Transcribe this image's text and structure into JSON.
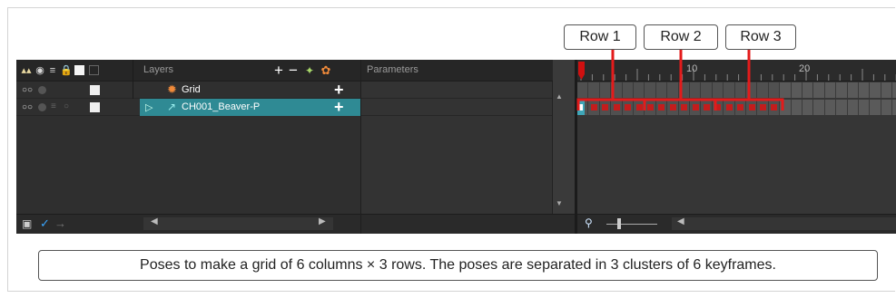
{
  "callouts": {
    "row1": "Row 1",
    "row2": "Row 2",
    "row3": "Row 3"
  },
  "layers_panel": {
    "header_label": "Layers",
    "parameters_label": "Parameters",
    "layers": [
      {
        "name": "Grid",
        "icon": "sun-icon",
        "selected": false
      },
      {
        "name": "CH001_Beaver-P",
        "icon": "peg-icon",
        "selected": true
      }
    ]
  },
  "timeline": {
    "ruler_labels": [
      "10",
      "20"
    ],
    "playhead_frame": "1",
    "keyframe_clusters": 3,
    "keyframes_per_cluster": 6
  },
  "caption": "Poses to make a grid of 6 columns × 3 rows. The poses are separated in 3 clusters of 6 keyframes.",
  "colors": {
    "accent_selected": "#2f8a94",
    "keyframe": "#c41c1c",
    "bracket": "#e31b1b"
  }
}
